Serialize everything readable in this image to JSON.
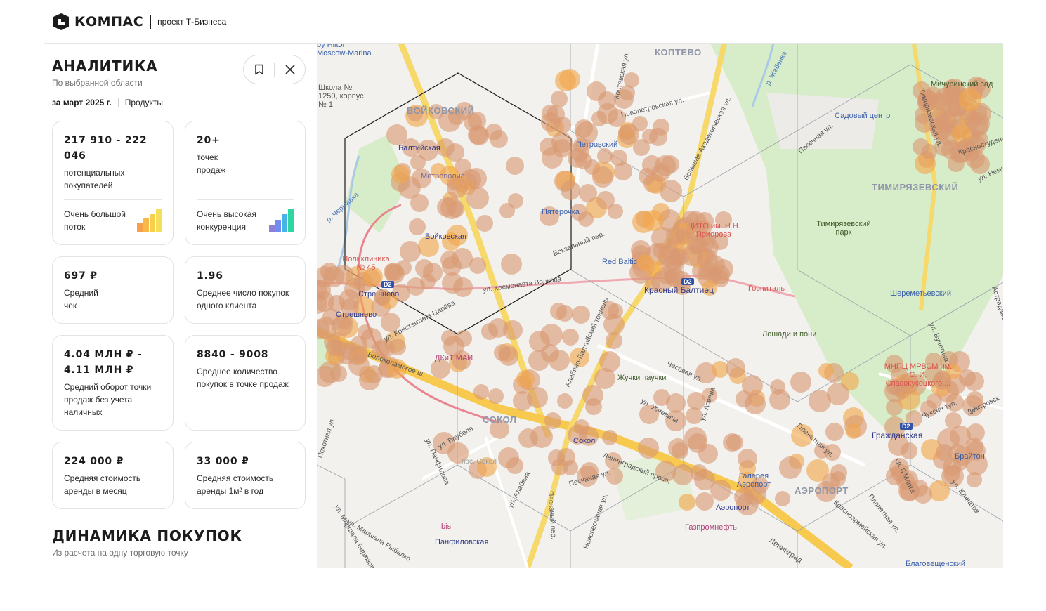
{
  "header": {
    "logo_text": "КОМПАС",
    "logo_sub": "проект Т-Бизнеса"
  },
  "panel": {
    "title": "АНАЛИТИКА",
    "subtitle": "По выбранной области",
    "period": "за март 2025 г.",
    "products_link": "Продукты",
    "bookmark_icon": "bookmark-icon",
    "close_icon": "close-icon"
  },
  "cards": {
    "buyers": {
      "value": "217 910 - 222 046",
      "label": "потенциальных покупателей",
      "rating": "Очень большой поток",
      "level": 4,
      "colors": [
        "#f6a14a",
        "#f8b94a",
        "#f7cf4a",
        "#f5df5a"
      ]
    },
    "points": {
      "value": "20+",
      "label": "точек продаж",
      "rating": "Очень высокая конкуренция",
      "level": 4,
      "colors": [
        "#8b7fd6",
        "#6f8df0",
        "#45b5e8",
        "#2fd6a2"
      ]
    },
    "check": {
      "value": "697 ₽",
      "label": "Средний чек"
    },
    "avg_purchases": {
      "value": "1.96",
      "label": "Среднее число покупок одного клиента"
    },
    "turnover": {
      "value": "4.04 МЛН ₽ - 4.11 МЛН ₽",
      "label": "Средний оборот точки продаж без учета наличных"
    },
    "purchases_point": {
      "value": "8840 - 9008",
      "label": "Среднее количество покупок в точке продаж"
    },
    "rent_month": {
      "value": "224 000 ₽",
      "label": "Средняя стоимость аренды в месяц"
    },
    "rent_m2": {
      "value": "33 000 ₽",
      "label": "Средняя стоимость аренды 1м² в год"
    }
  },
  "dynamics": {
    "title": "ДИНАМИКА ПОКУПОК",
    "subtitle": "Из расчета на одну торговую точку"
  },
  "map": {
    "districts": [
      "КОПТЕВО",
      "ВОЙКОВСКИЙ",
      "ТИМИРЯЗЕВСКИЙ",
      "СОКОЛ",
      "АЭРОПОРТ"
    ],
    "stations": [
      "Балтийская",
      "Войковская",
      "Стрешнево",
      "Стрешнево",
      "Красный Балтиец",
      "Сокол",
      "Аэропорт",
      "Панфиловская",
      "Гражданская"
    ],
    "places": [
      "Метрополис",
      "Петровский",
      "Пятёрочка",
      "Садовый центр",
      "Мичуринский сад",
      "Тимирязевский парк",
      "ЦИТО им. Н.Н. Приорова",
      "Red Baltic",
      "Госпиталь",
      "Шереметьевский",
      "Лошади и пони",
      "МНПЦ МРВСМ им. С. И. Спасокукоцкого,...",
      "ДКиТ МАИ",
      "Жучки паучки",
      "Поликлиника № 45",
      "Галерея Аэропорт",
      "Газпромнефть",
      "Ibis",
      "Брайтон",
      "Благовещенский",
      "Школа № 1250, корпус № 1",
      "by Hilton Moscow-Marina"
    ],
    "streets": [
      "Коптевская ул.",
      "Новопетровская ул.",
      "Большая Академическая ул.",
      "ул. Космонавта Волкова",
      "Вокзальный пер.",
      "Волоколамское ш.",
      "Ленинградский просп.",
      "Алабяно-Балтийский тоннель",
      "ул. Константина Царёва",
      "Часовая ул.",
      "ул. Усиевича",
      "Планетная ул.",
      "ул. Врубеля",
      "пос. Сокол",
      "ул. Алабяна",
      "Песчаная ул.",
      "Новопесчаная ул.",
      "Пасечная ул.",
      "Тимирязевская ул.",
      "ул. 8 Марта",
      "Чуксин туп.",
      "Астрадамская ул.",
      "ул. Вучетича",
      "ул. Панфилова",
      "ул. Маршала Бирюзова",
      "Пехотная ул.",
      "ул. Асеева",
      "Красноармейская ул.",
      "Планетная ул.",
      "ул. Юннатов",
      "Дмитровск",
      "Красностуденч",
      "ул. Немч",
      "р. Жабенка",
      "р. Чернушка",
      "ул. Маршала Рыбалко",
      "Песчаный пер.",
      "Ленинград"
    ],
    "line_badges": [
      "D2",
      "D2",
      "D2"
    ]
  }
}
